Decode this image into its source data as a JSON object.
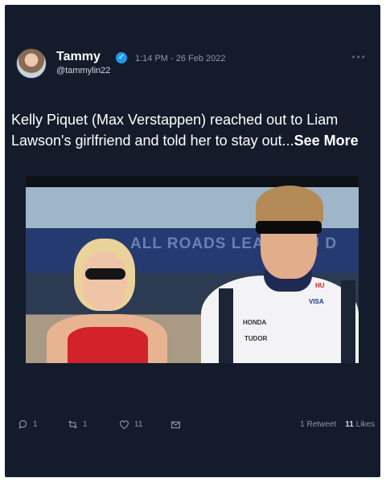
{
  "tweet": {
    "author_name": "Tammy",
    "author_handle": "@tammylin22",
    "timestamp": "1:14 PM - 26 Feb 2022",
    "verified": true,
    "text": "Kelly Piquet (Max Verstappen) reached out to Liam Lawson's girlfriend and told her to stay out...",
    "see_more": "See More",
    "image_sponsor_labels": [
      "ALL ROADS LEA",
      "ABU D",
      "HU",
      "VISA",
      "HONDA",
      "TUDOR"
    ]
  },
  "actions": {
    "reply_count": "1",
    "retweet_count": "1",
    "like_count": "11"
  },
  "stats": {
    "retweets_value": "1",
    "retweets_label": "Retweet",
    "likes_value": "11",
    "likes_label": "Likes"
  },
  "colors": {
    "card_background": "#141c2b",
    "verified_badge": "#1d9bf0",
    "muted_text": "#8b96a8"
  },
  "icons": [
    "verified-badge-icon",
    "more-icon",
    "reply-icon",
    "retweet-icon",
    "like-icon",
    "message-icon"
  ]
}
